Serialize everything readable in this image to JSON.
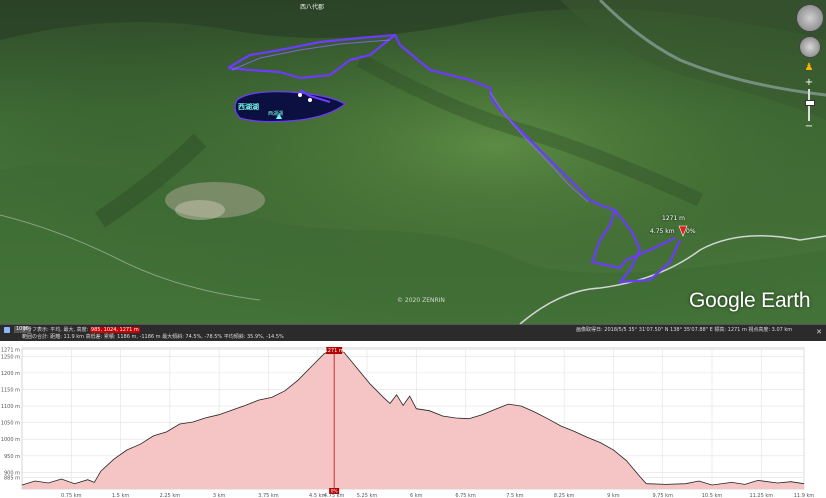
{
  "map": {
    "place_label_top": "西八代郡",
    "lake_label": "西湖湖",
    "lake_sublabel": "西湖湖",
    "marker_elevation": "1271 m",
    "marker_distance": "4.75 km",
    "marker_percent": "0%",
    "copyright": "© 2020 ZENRIN",
    "logo": "Google Earth",
    "colors": {
      "track": "#6d3bff",
      "marker": "#e0201b",
      "road": "#cfd6d3"
    },
    "icons": [
      "look-icon",
      "move-icon",
      "pegman-icon",
      "zoom-plus-icon",
      "zoom-minus-icon"
    ]
  },
  "statusbar": {
    "badge": "1096",
    "line1_prefix": "グラフ表示: 平均, 最大, 高度:",
    "line1_selected": "985, 1024, 1271 m",
    "line2": "範囲の合計: 距離: 11.9 km 高低差: 累積: 1186 m, -1186 m 最大傾斜: 74.5%, -78.5% 平均傾斜: 35.9%, -14.5%",
    "right": "画像取得日: 2018/5/5   35° 31'07.50\" N  138° 35'07.88\" E  標高: 1271 m  視点高度: 3.07 km"
  },
  "chart_data": {
    "type": "area",
    "title": "",
    "xlabel": "",
    "ylabel": "",
    "x_unit": "km",
    "y_unit": "m",
    "xlim": [
      0,
      11.9
    ],
    "ylim": [
      850,
      1275
    ],
    "y_ticks": [
      "1271 m",
      "1250 m",
      "1200 m",
      "1150 m",
      "1100 m",
      "1050 m",
      "1000 m",
      "950 m",
      "900 m",
      "885 m"
    ],
    "y_tick_values": [
      1271,
      1250,
      1200,
      1150,
      1100,
      1050,
      1000,
      950,
      900,
      885
    ],
    "x_ticks": [
      "0.75 km",
      "1.5 km",
      "2.25 km",
      "3 km",
      "3.75 km",
      "4.5 km",
      "4.75 km",
      "5.25 km",
      "6 km",
      "6.75 km",
      "7.5 km",
      "8.25 km",
      "9 km",
      "9.75 km",
      "10.5 km",
      "11.25 km",
      "11.9 km"
    ],
    "x_tick_values": [
      0.75,
      1.5,
      2.25,
      3,
      3.75,
      4.5,
      4.75,
      5.25,
      6,
      6.75,
      7.5,
      8.25,
      9,
      9.75,
      10.5,
      11.25,
      11.9
    ],
    "cursor": {
      "x": 4.75,
      "label": "1271 m",
      "bottom_label": "0%"
    },
    "fill_color": "#f5c5c5",
    "line_color": "#222222",
    "points": [
      [
        0.0,
        862
      ],
      [
        0.2,
        874
      ],
      [
        0.4,
        868
      ],
      [
        0.6,
        880
      ],
      [
        0.8,
        866
      ],
      [
        1.0,
        878
      ],
      [
        1.1,
        870
      ],
      [
        1.2,
        904
      ],
      [
        1.4,
        940
      ],
      [
        1.6,
        968
      ],
      [
        1.8,
        985
      ],
      [
        2.0,
        1010
      ],
      [
        2.2,
        1022
      ],
      [
        2.4,
        1046
      ],
      [
        2.6,
        1052
      ],
      [
        2.8,
        1065
      ],
      [
        3.0,
        1074
      ],
      [
        3.2,
        1088
      ],
      [
        3.4,
        1102
      ],
      [
        3.6,
        1118
      ],
      [
        3.8,
        1126
      ],
      [
        4.0,
        1146
      ],
      [
        4.2,
        1178
      ],
      [
        4.4,
        1218
      ],
      [
        4.6,
        1258
      ],
      [
        4.75,
        1271
      ],
      [
        4.9,
        1262
      ],
      [
        5.1,
        1214
      ],
      [
        5.3,
        1166
      ],
      [
        5.5,
        1126
      ],
      [
        5.6,
        1108
      ],
      [
        5.7,
        1134
      ],
      [
        5.8,
        1102
      ],
      [
        5.9,
        1130
      ],
      [
        6.0,
        1092
      ],
      [
        6.2,
        1086
      ],
      [
        6.4,
        1070
      ],
      [
        6.6,
        1064
      ],
      [
        6.8,
        1062
      ],
      [
        7.0,
        1074
      ],
      [
        7.2,
        1090
      ],
      [
        7.4,
        1106
      ],
      [
        7.6,
        1100
      ],
      [
        7.8,
        1082
      ],
      [
        8.0,
        1062
      ],
      [
        8.2,
        1040
      ],
      [
        8.4,
        1024
      ],
      [
        8.6,
        1006
      ],
      [
        8.8,
        990
      ],
      [
        9.0,
        968
      ],
      [
        9.2,
        935
      ],
      [
        9.4,
        888
      ],
      [
        9.5,
        866
      ],
      [
        9.8,
        864
      ],
      [
        10.1,
        866
      ],
      [
        10.3,
        874
      ],
      [
        10.5,
        862
      ],
      [
        10.8,
        870
      ],
      [
        11.0,
        864
      ],
      [
        11.2,
        876
      ],
      [
        11.5,
        868
      ],
      [
        11.7,
        872
      ],
      [
        11.9,
        866
      ]
    ]
  }
}
